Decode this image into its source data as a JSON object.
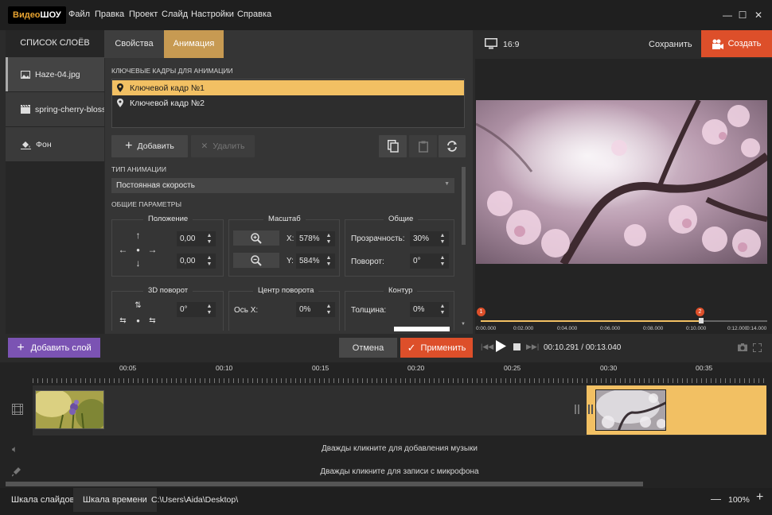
{
  "app": {
    "logo_prefix": "Видео",
    "logo_suffix": "ШОУ"
  },
  "menu": [
    "Файл",
    "Правка",
    "Проект",
    "Слайд",
    "Настройки",
    "Справка"
  ],
  "layers": {
    "title": "СПИСОК СЛОЁВ",
    "items": [
      {
        "label": "Haze-04.jpg",
        "icon": "image-icon"
      },
      {
        "label": "spring-cherry-bloss...",
        "icon": "video-clip-icon"
      },
      {
        "label": "Фон",
        "icon": "fill-bucket-icon"
      }
    ]
  },
  "tabs": {
    "properties": "Свойства",
    "animation": "Анимация"
  },
  "keyframes": {
    "section_label": "КЛЮЧЕВЫЕ КАДРЫ ДЛЯ АНИМАЦИИ",
    "items": [
      "Ключевой кадр №1",
      "Ключевой кадр №2"
    ],
    "add_label": "Добавить",
    "delete_label": "Удалить"
  },
  "animation_type": {
    "section_label": "ТИП АНИМАЦИИ",
    "selected": "Постоянная скорость"
  },
  "general_params": {
    "section_label": "ОБЩИЕ ПАРАМЕТРЫ",
    "position": {
      "title": "Положение",
      "x": "0,00",
      "y": "0,00"
    },
    "scale": {
      "title": "Масштаб",
      "x_label": "X:",
      "x_value": "578%",
      "y_label": "Y:",
      "y_value": "584%"
    },
    "common": {
      "title": "Общие",
      "opacity_label": "Прозрачность:",
      "opacity_value": "30%",
      "rotation_label": "Поворот:",
      "rotation_value": "0°"
    },
    "rotation3d": {
      "title": "3D поворот",
      "value1": "0°"
    },
    "rotation_center": {
      "title": "Центр поворота",
      "x_label": "Ось X:",
      "x_value": "0%"
    },
    "outline": {
      "title": "Контур",
      "thickness_label": "Толщина:",
      "thickness_value": "0%"
    }
  },
  "preview": {
    "aspect": "16:9",
    "save_label": "Сохранить",
    "create_label": "Создать",
    "markers": [
      "1",
      "2"
    ],
    "ruler_labels": [
      "0:00.000",
      "0:02.000",
      "0:04.000",
      "0:06.000",
      "0:08.000",
      "0:10.000",
      "0:12.000",
      "0:14.000"
    ],
    "time_current": "00:10.291",
    "time_total": "00:13.040",
    "time_separator": "/"
  },
  "actions": {
    "add_layer": "Добавить слой",
    "cancel": "Отмена",
    "apply": "Применить"
  },
  "timeline": {
    "ticks": [
      "00:05",
      "00:10",
      "00:15",
      "00:20",
      "00:25",
      "00:30",
      "00:35"
    ],
    "music_hint": "Дважды кликните для добавления музыки",
    "mic_hint": "Дважды кликните для записи с микрофона"
  },
  "bottom": {
    "tab_slides": "Шкала слайдов",
    "tab_timeline": "Шкала времени",
    "path": "C:\\Users\\Aida\\Desktop\\",
    "zoom": "100%"
  },
  "colors": {
    "accent_gold": "#c79a52",
    "selection_yellow": "#f2c063",
    "create_orange": "#dd4f2a",
    "purple": "#7b53b3"
  }
}
